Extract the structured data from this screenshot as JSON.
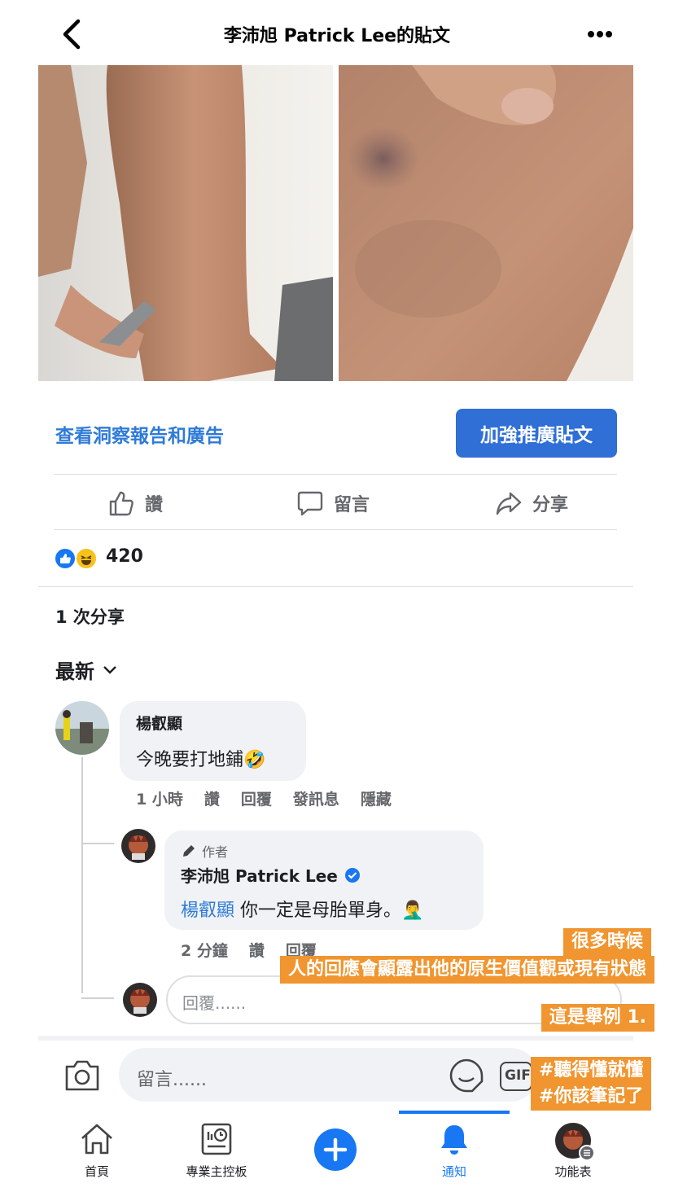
{
  "header": {
    "title": "李沛旭 Patrick Lee的貼文",
    "back_icon": "chevron-left-icon",
    "more_icon": "more-horizontal-icon"
  },
  "post": {
    "insights_link": "查看洞察報告和廣告",
    "boost_button": "加強推廣貼文",
    "actions": {
      "like": "讚",
      "comment": "留言",
      "share": "分享"
    },
    "reaction_count": "420",
    "shares": "1 次分享",
    "sort_label": "最新"
  },
  "comments": [
    {
      "author": "楊叡顯",
      "text": "今晚要打地鋪🤣",
      "meta": [
        "1 小時",
        "讚",
        "回覆",
        "發訊息",
        "隱藏"
      ],
      "replies": [
        {
          "badge": "作者",
          "author": "李沛旭 Patrick Lee",
          "mention": "楊叡顯",
          "text": "你一定是母胎單身。🤦‍♂️",
          "meta": [
            "2 分鐘",
            "讚",
            "回覆"
          ]
        }
      ]
    }
  ],
  "reply_input": {
    "placeholder": "回覆......"
  },
  "comment_input": {
    "placeholder": "留言......",
    "gif_label": "GIF"
  },
  "overlay": {
    "line1": "很多時候",
    "line2": "人的回應會顯露出他的原生價值觀或現有狀態",
    "line3": "這是舉例 1.",
    "line4": "#聽得懂就懂",
    "line5": "#你該筆記了"
  },
  "tabs": [
    {
      "label": "首頁",
      "icon": "home-icon"
    },
    {
      "label": "專業主控板",
      "icon": "dashboard-icon"
    },
    {
      "label": "",
      "icon": "plus-circle-icon"
    },
    {
      "label": "通知",
      "icon": "bell-icon",
      "active": true
    },
    {
      "label": "功能表",
      "icon": "profile-menu-icon"
    }
  ],
  "colors": {
    "accent": "#2f6fd6",
    "link": "#2f7bd8",
    "overlay": "#f0952f"
  }
}
